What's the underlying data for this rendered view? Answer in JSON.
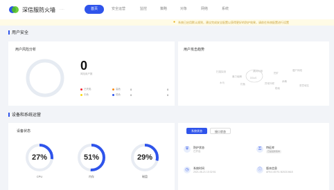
{
  "header": {
    "brand": "深信服防火墙",
    "brand_sub": "·····",
    "nav": [
      {
        "label": "首页",
        "active": true
      },
      {
        "label": "安全运营",
        "active": false
      },
      {
        "label": "监控",
        "active": false
      },
      {
        "label": "策略",
        "active": false
      },
      {
        "label": "对象",
        "active": false
      },
      {
        "label": "网络",
        "active": false
      },
      {
        "label": "系统",
        "active": false
      }
    ]
  },
  "notice": {
    "text": "系统已启用默认规则，建议完成安全配置以获得更好的防护效果，请前往系统配置进行设置"
  },
  "sections": {
    "user_security": "用户安全",
    "device_status": "设备和系统运营"
  },
  "risk_card": {
    "title": "用户风险分析",
    "count": "0",
    "count_sub": "风险用户数",
    "legend": [
      {
        "label": "已失陷",
        "value": "0",
        "color": "#f5222d"
      },
      {
        "label": "高危",
        "value": "0",
        "color": "#fa8c16"
      },
      {
        "label": "中危",
        "value": "0",
        "color": "#fadb14"
      },
      {
        "label": "低危",
        "value": "0",
        "color": "#2f54eb"
      }
    ]
  },
  "trend_card": {
    "title": "用户攻击趋势",
    "words": [
      "扫描探测",
      "暴力破解",
      "漏洞利用",
      "挖矿",
      "僵尸网络",
      "木马",
      "钓鱼",
      "异常外联",
      "病毒",
      "恶意域名",
      "DDoS",
      "勒索"
    ]
  },
  "device_card": {
    "title": "设备状态",
    "gauges": [
      {
        "name": "CPU",
        "value": 27,
        "label": "27%"
      },
      {
        "name": "内存",
        "value": 51,
        "label": "51%"
      },
      {
        "name": "磁盘",
        "value": 29,
        "label": "29%"
      }
    ],
    "accent": "#2f54eb"
  },
  "system_card": {
    "tabs": [
      {
        "label": "系统状态",
        "active": true
      },
      {
        "label": "接口状态",
        "active": false
      }
    ],
    "items": [
      {
        "icon": "shield-icon",
        "glyph": "⛨",
        "title": "防护状态",
        "value": "已开启"
      },
      {
        "icon": "lock-icon",
        "glyph": "⚿",
        "title": "特征库",
        "value": "",
        "badge": "已是最新版本"
      },
      {
        "icon": "clock-icon",
        "glyph": "◷",
        "title": "系统时间",
        "value": "2021-06-21 10:32:51"
      },
      {
        "icon": "info-icon",
        "glyph": "ⓘ",
        "title": "版本信息",
        "value": "AF8.0.45 R1 B20210618"
      }
    ]
  }
}
